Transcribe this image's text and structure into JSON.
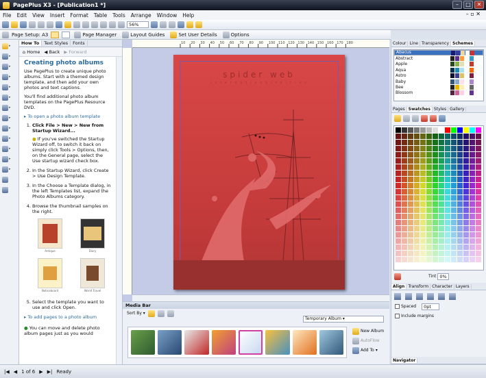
{
  "window": {
    "title": "PagePlus X3 - [Publication1 *]"
  },
  "menu": [
    "File",
    "Edit",
    "View",
    "Insert",
    "Format",
    "Table",
    "Tools",
    "Arrange",
    "Window",
    "Help"
  ],
  "toolbar": {
    "zoom": "56%"
  },
  "context_bar": {
    "page_setup": "Page Setup: A3",
    "page_manager": "Page Manager",
    "layout_guides": "Layout Guides",
    "user_details": "Set User Details",
    "options": "Options"
  },
  "howto": {
    "tabs": [
      "How To",
      "Text Styles",
      "Fonts"
    ],
    "nav": {
      "home": "Home",
      "back": "Back",
      "forward": "Forward"
    },
    "heading": "Creating photo albums",
    "intro": "Use PagePlus to create unique photo albums. Start with a themed design template, and then add your own photos and text captions.",
    "resource": "You'll find additional photo album templates on the PagePlus Resource DVD.",
    "link_open": "To open a photo album template",
    "steps": [
      "Click File > New > New from Startup Wizard...",
      "In the Startup Wizard, click Create > Use Design Template.",
      "In the Choose a Template dialog, in the left Templates list, expand the Photo Albums category.",
      "Browse the thumbnail samples on the right."
    ],
    "tip": "If you've switched the Startup Wizard off, to switch it back on simply click Tools > Options, then, on the General page, select the Use startup wizard check box.",
    "thumbs": [
      "Antique",
      "Diary",
      "Noticeboard",
      "World Travel"
    ],
    "step5": "Select the template you want to use and click Open.",
    "link_add": "To add pages to a photo album",
    "bottom_note": "You can move and delete photo album pages just as you would"
  },
  "page": {
    "title": "spider web",
    "subtitle": "i n t e r n a t i o n a l   e d i t i o n"
  },
  "ruler_ticks": [
    "10",
    "20",
    "30",
    "40",
    "50",
    "60",
    "70",
    "80",
    "90",
    "100",
    "110",
    "120",
    "130",
    "140",
    "150",
    "160",
    "170",
    "180"
  ],
  "mediabar": {
    "title": "Media Bar",
    "sort_by": "Sort By",
    "album_select": "Temporary Album",
    "new_album": "New Album",
    "autoflow": "AutoFlow",
    "add_to": "Add To"
  },
  "right": {
    "tabs1": [
      "Colour",
      "Line",
      "Transparency",
      "Schemes"
    ],
    "schemes": [
      {
        "name": "Abacus",
        "colors": [
          "#1a1a6e",
          "#3c3c9e",
          "#e8d8a8",
          "#ffffff",
          "#c83232"
        ]
      },
      {
        "name": "Abstract",
        "colors": [
          "#222",
          "#5a2e8c",
          "#ff9933",
          "#ffffff",
          "#3399cc"
        ]
      },
      {
        "name": "Apple",
        "colors": [
          "#2c4a1e",
          "#88b04b",
          "#e0e0b0",
          "#ffffff",
          "#c0392b"
        ]
      },
      {
        "name": "Aqua",
        "colors": [
          "#00334e",
          "#1f8bb3",
          "#a8e0f0",
          "#ffffff",
          "#ff6600"
        ]
      },
      {
        "name": "Astro",
        "colors": [
          "#101030",
          "#404090",
          "#e0c060",
          "#ffffff",
          "#802040"
        ]
      },
      {
        "name": "Baby",
        "colors": [
          "#335577",
          "#88aacc",
          "#ffe0ea",
          "#ffffff",
          "#aa88cc"
        ]
      },
      {
        "name": "Bee",
        "colors": [
          "#222",
          "#e8b800",
          "#ffeeaa",
          "#ffffff",
          "#666"
        ]
      },
      {
        "name": "Blossom",
        "colors": [
          "#552244",
          "#cc6699",
          "#ffd0e0",
          "#ffffff",
          "#663399"
        ]
      }
    ],
    "tabs2": [
      "Pages",
      "Swatches",
      "Styles",
      "Gallery"
    ],
    "tint_label": "Tint",
    "tint_value": "0%",
    "tabs3": [
      "Align",
      "Transform",
      "Character",
      "Layers"
    ],
    "spaced": "Spaced",
    "spaced_value": "0pt",
    "include_margins": "Include margins",
    "navigator": "Navigator"
  },
  "status": {
    "page_of": "1 of 6",
    "ready": "Ready"
  }
}
